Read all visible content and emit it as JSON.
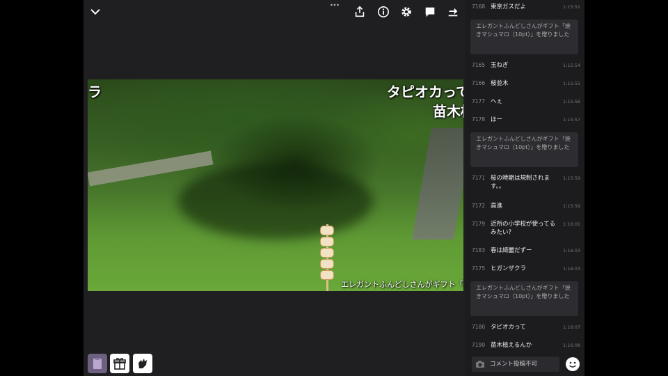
{
  "player": {
    "overlays": [
      {
        "text": "ラ"
      },
      {
        "text": "タピオカって"
      },
      {
        "text": "苗木植"
      },
      {
        "text": "エレガントふんどしさんがギフト「焼"
      }
    ]
  },
  "chat": {
    "messages": [
      {
        "num": "7168",
        "text": "東京ガスだよ",
        "time": "1:15:51"
      },
      {
        "num": "7165",
        "text": "玉ねぎ",
        "time": "1:15:54"
      },
      {
        "num": "7166",
        "text": "桜並木",
        "time": "1:15:55"
      },
      {
        "num": "7177",
        "text": "へぇ",
        "time": "1:15:56"
      },
      {
        "num": "7178",
        "text": "ほー",
        "time": "1:15:57"
      },
      {
        "num": "7171",
        "text": "桜の時期は規制されます。。",
        "time": "1:15:59"
      },
      {
        "num": "7172",
        "text": "高進",
        "time": "1:15:59"
      },
      {
        "num": "7179",
        "text": "近所の小学校が使ってるみたい？",
        "time": "1:16:01"
      },
      {
        "num": "7183",
        "text": "春は綺麗だずー",
        "time": "1:16:03"
      },
      {
        "num": "7175",
        "text": "ヒガンザクラ",
        "time": "1:16:03"
      },
      {
        "num": "7180",
        "text": "タピオカって",
        "time": "1:16:07"
      },
      {
        "num": "7190",
        "text": "苗木植えるんか",
        "time": "1:16:08"
      }
    ],
    "gifts": [
      "エレガントふんどしさんがギフト「焼きマシュマロ（10pt）」を贈りました",
      "エレガントふんどしさんがギフト「焼きマシュマロ（10pt）」を贈りました",
      "エレガントふんどしさんがギフト「焼きマシュマロ（10pt）」を贈りました"
    ],
    "input_placeholder": "コメント投稿不可"
  },
  "icons": {
    "collapse": "chevron-down-icon",
    "more": "more-dots-icon",
    "share": "share-icon",
    "info": "info-icon",
    "settings": "gear-icon",
    "comment": "comment-icon",
    "skip": "skip-icon",
    "gift": "gift-icon",
    "cheer": "clap-icon",
    "emoji": "emoji-icon"
  },
  "colors": {
    "background": "#000000",
    "player_bg": "#1f1f22",
    "chat_bg": "#1c1c1e",
    "gift_bg": "#2d2d31"
  }
}
